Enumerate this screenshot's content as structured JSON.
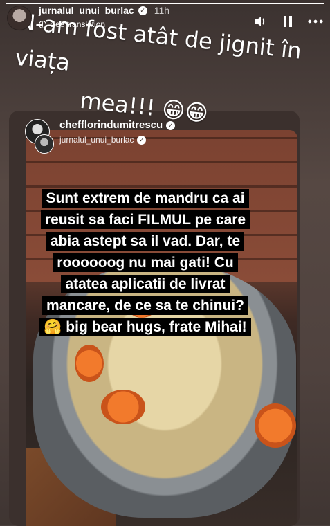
{
  "progress": {
    "fraction": 1.0
  },
  "header": {
    "username": "jurnalul_unui_burlac",
    "time": "11h",
    "see_translation": "See translation",
    "controls": [
      "speaker-icon",
      "pause-icon",
      "more-icon"
    ]
  },
  "caption": {
    "line1": "N-am fost atât de jignit în viața",
    "line2": "mea!!! 😁😁"
  },
  "shared_post": {
    "owner": "chefflorindumitrescu",
    "collaborator": "jurnalul_unui_burlac",
    "message_lines": [
      "Sunt extrem de mandru ca ai",
      "reusit sa faci FILMUL pe care",
      "abia astept sa il vad. Dar, te",
      "roooooog nu mai gati! Cu",
      "atatea aplicatii de livrat",
      "mancare, de ce sa te chinui?",
      "🤗 big bear hugs, frate Mihai!"
    ]
  }
}
